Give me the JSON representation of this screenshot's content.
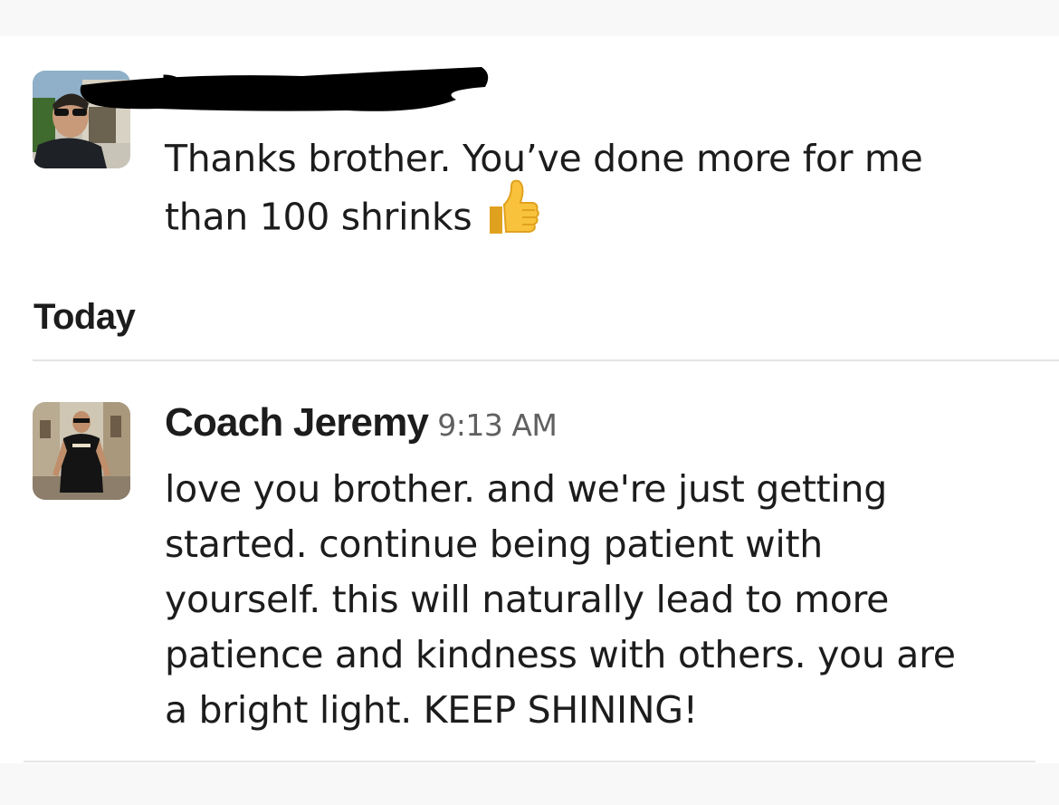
{
  "messages": [
    {
      "sender": "",
      "sender_redacted": true,
      "avatar": "photo-man-sunglasses",
      "lines": [
        "Thanks brother. You’ve done more for me",
        "than 100 shrinks"
      ],
      "emoji": "thumbs-up-emoji"
    },
    {
      "sender": "Coach Jeremy",
      "timestamp": "9:13 AM",
      "avatar": "photo-man-street",
      "lines": [
        "love you brother. and we're just getting",
        "started. continue being patient with",
        "yourself. this will naturally lead to more",
        "patience and kindness with others. you are",
        "a bright light. KEEP SHINING!"
      ]
    }
  ],
  "day_divider": {
    "label": "Today"
  },
  "colors": {
    "text": "#1d1c1d",
    "timestamp": "#616061",
    "divider": "#e4e4e4",
    "redaction": "#000000"
  }
}
